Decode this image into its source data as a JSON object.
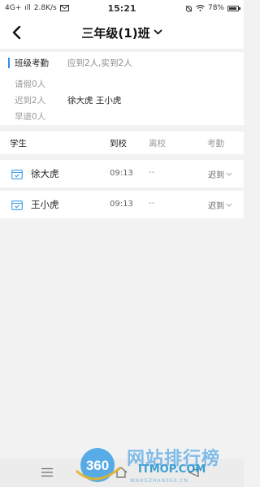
{
  "status_bar": {
    "network": "4G+",
    "signal": "ıll",
    "speed": "2.8K/s",
    "time": "15:21",
    "battery": "78%"
  },
  "navbar": {
    "title": "三年级(1)班"
  },
  "summary": {
    "header_label": "班级考勤",
    "expected_actual": "应到2人,实到2人",
    "leave": "请假0人",
    "late": "迟到2人",
    "late_names": "徐大虎 王小虎",
    "early": "早退0人"
  },
  "table": {
    "headers": {
      "student": "学生",
      "arrive": "到校",
      "leave": "离校",
      "attendance": "考勤"
    },
    "rows": [
      {
        "name": "徐大虎",
        "arrive": "09:13",
        "leave": "--",
        "status": "迟到"
      },
      {
        "name": "王小虎",
        "arrive": "09:13",
        "leave": "--",
        "status": "迟到"
      }
    ]
  },
  "watermark": {
    "logo_number": "360",
    "text": "网站排行榜",
    "sub": "ITMOP.COM",
    "domain": "WANGZHAN360.CN"
  },
  "colors": {
    "accent": "#2f8ef4",
    "background": "#f2f2f2"
  },
  "icons": {
    "back": "chevron-left-icon",
    "title_dropdown": "chevron-down-icon",
    "row_icon": "calendar-check-icon",
    "status_dropdown": "chevron-down-icon",
    "nav_menu": "menu-icon",
    "nav_home": "home-icon",
    "nav_back": "back-icon"
  }
}
